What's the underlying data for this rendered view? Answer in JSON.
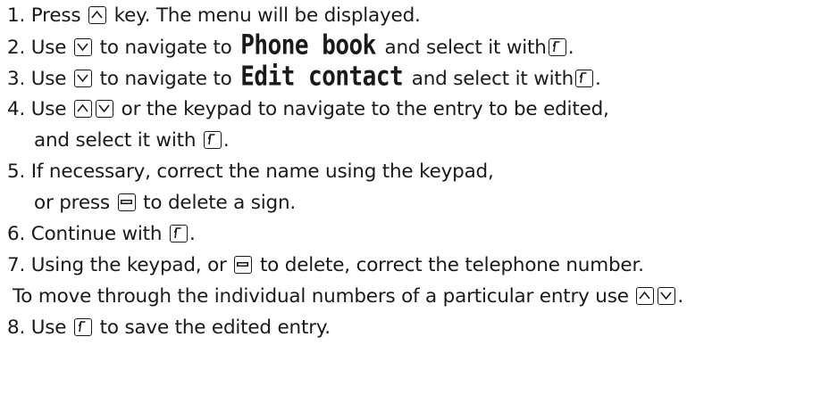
{
  "steps": [
    {
      "num": "1.",
      "parts": [
        "Press",
        "key. The menu will be displayed."
      ]
    },
    {
      "num": "2.",
      "parts": [
        "Use",
        "to navigate to",
        "Phone book",
        "and select it with",
        "."
      ]
    },
    {
      "num": "3.",
      "parts": [
        "Use",
        "to navigate to",
        "Edit contact",
        "and select it with",
        "."
      ]
    },
    {
      "num": "4.",
      "parts": [
        "Use",
        "or the keypad to navigate to the entry to be edited,",
        "and select it with",
        "."
      ]
    },
    {
      "num": "5.",
      "parts": [
        "If necessary, correct the name using the keypad,",
        "or press",
        "to delete a sign."
      ]
    },
    {
      "num": "6.",
      "parts": [
        "Continue with",
        "."
      ]
    },
    {
      "num": "7.",
      "parts": [
        "Using the keypad, or",
        "to delete, correct the telephone number.",
        "To move through the individual numbers of a particular entry use",
        "."
      ]
    },
    {
      "num": "8.",
      "parts": [
        "Use",
        "to save the edited entry."
      ]
    }
  ]
}
